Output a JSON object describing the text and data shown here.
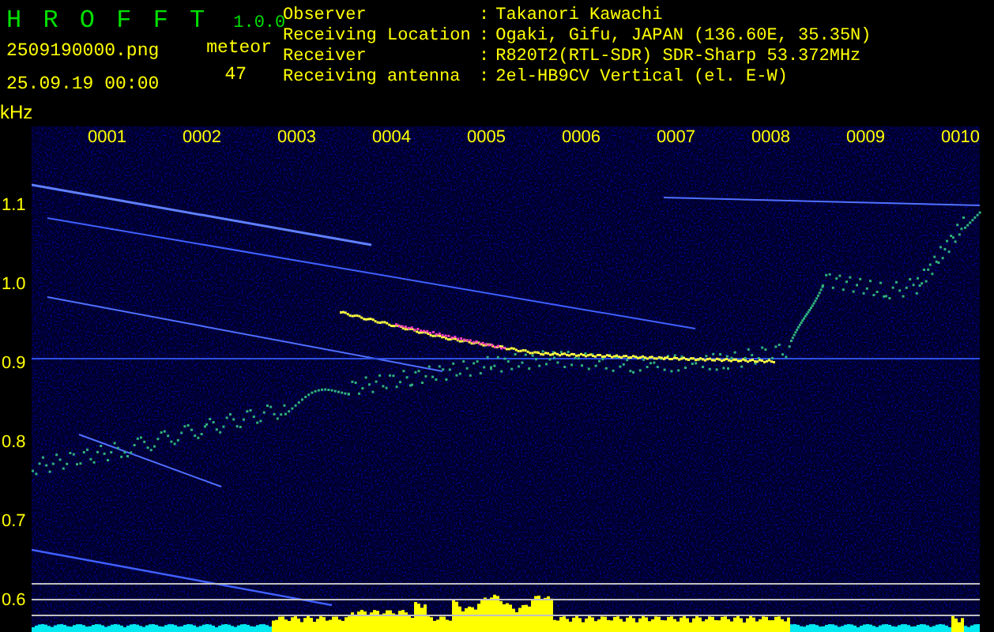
{
  "app": {
    "name": "H R O F F T",
    "version": "1.0.0"
  },
  "file_name": "2509190000.png",
  "timestamp": "25.09.19 00:00",
  "meteor": {
    "label": "meteor",
    "count": "47"
  },
  "info": [
    {
      "label": "Observer",
      "separator": ":",
      "value": "Takanori Kawachi"
    },
    {
      "label": "Receiving Location",
      "separator": ":",
      "value": "Ogaki, Gifu, JAPAN (136.60E, 35.35N)"
    },
    {
      "label": "Receiver",
      "separator": ":",
      "value": "R820T2(RTL-SDR) SDR-Sharp 53.372MHz"
    },
    {
      "label": "Receiving antenna",
      "separator": ":",
      "value": "2el-HB9CV Vertical (el. E-W)"
    }
  ],
  "spectrogram": {
    "y_unit": "kHz",
    "y_labels": [
      "1.1",
      "1.0",
      "0.9",
      "0.8",
      "0.7",
      "0.6"
    ],
    "x_labels": [
      "0001",
      "0002",
      "0003",
      "0004",
      "0005",
      "0006",
      "0007",
      "0008",
      "0009",
      "0010"
    ]
  }
}
